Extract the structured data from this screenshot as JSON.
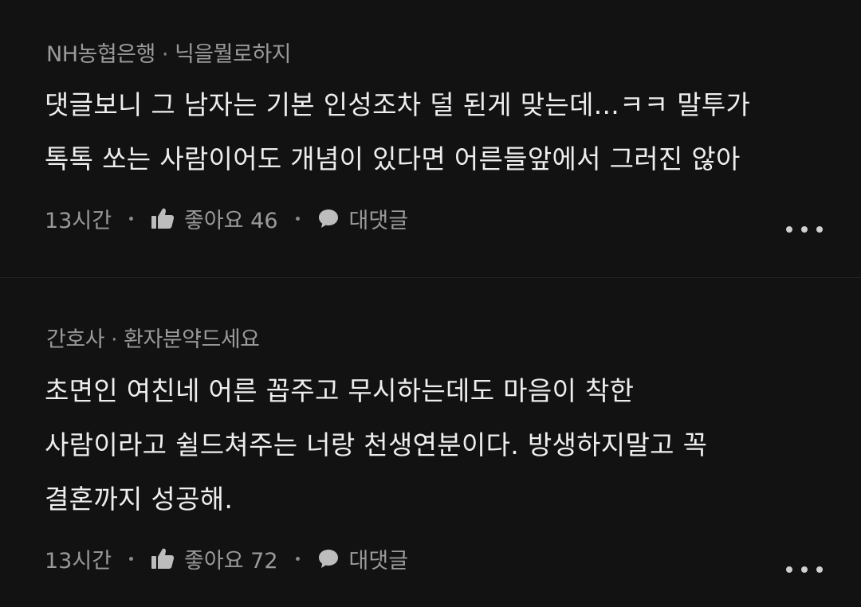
{
  "comments": [
    {
      "author": "NH농협은행",
      "nickname": "닉을뭘로하지",
      "separator": "·",
      "lines": [
        "댓글보니 그 남자는 기본 인성조차 덜 된게 맞는데...ㅋㅋ 말투가",
        "톡톡 쏘는 사람이어도 개념이 있다면 어른들앞에서 그러진 않아"
      ],
      "time": "13시간",
      "like_label": "좋아요 46",
      "reply_label": "대댓글"
    },
    {
      "author": "간호사",
      "nickname": "환자분약드세요",
      "separator": "·",
      "lines": [
        "초면인 여친네 어른 꼽주고 무시하는데도 마음이 착한",
        "사람이라고 쉴드쳐주는 너랑 천생연분이다. 방생하지말고 꼭",
        "결혼까지 성공해."
      ],
      "time": "13시간",
      "like_label": "좋아요 72",
      "reply_label": "대댓글"
    }
  ],
  "icons": {
    "like": "thumbs-up-icon",
    "reply": "speech-bubble-icon",
    "more": "more-options-icon"
  },
  "colors": {
    "background": "#121212",
    "text": "#eeeeee",
    "muted": "#9a9a9a"
  }
}
